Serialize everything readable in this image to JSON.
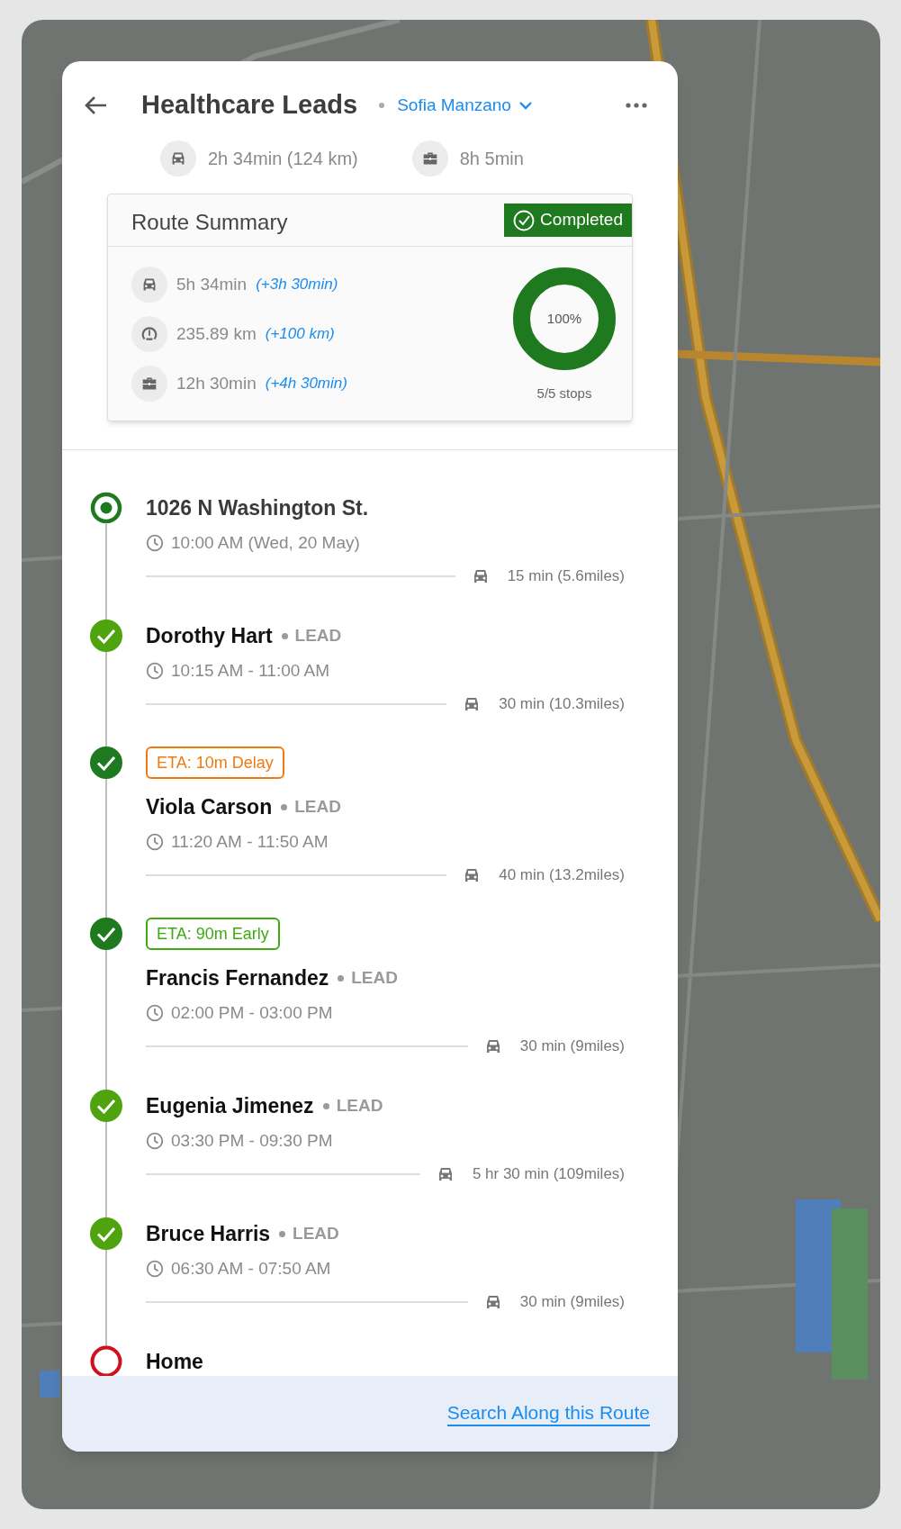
{
  "header": {
    "title": "Healthcare Leads",
    "assignee": "Sofia Manzano"
  },
  "totals": [
    {
      "kind": "drive",
      "text": "2h 34min (124 km)"
    },
    {
      "kind": "work",
      "text": "8h 5min"
    }
  ],
  "route_summary": {
    "title": "Route Summary",
    "status": "Completed",
    "rows": [
      {
        "kind": "drive",
        "value": "5h 34min",
        "delta": "(+3h 30min)"
      },
      {
        "kind": "distance",
        "value": "235.89 km",
        "delta": "(+100 km)"
      },
      {
        "kind": "work",
        "value": "12h 30min",
        "delta": "(+4h 30min)"
      }
    ],
    "progress": {
      "level": 1,
      "label": "100%",
      "stops": "5/5 stops"
    }
  },
  "stops": [
    {
      "kind": "start",
      "color": "#1f7a1f",
      "name": "1026 N Washington St.",
      "time": "10:00 AM (Wed, 20 May)",
      "leg": "15 min (5.6miles)"
    },
    {
      "kind": "completed",
      "color": "#4ea30f",
      "name": "Dorothy Hart",
      "tag": "LEAD",
      "time": "10:15 AM - 11:00 AM",
      "leg": "30 min (10.3miles)"
    },
    {
      "kind": "completed",
      "color": "#1f7a1f",
      "eta": {
        "kind": "delay",
        "text": "ETA: 10m Delay"
      },
      "name": "Viola Carson",
      "tag": "LEAD",
      "time": "11:20 AM - 11:50 AM",
      "leg": "40 min (13.2miles)"
    },
    {
      "kind": "completed",
      "color": "#1f7a1f",
      "eta": {
        "kind": "early",
        "text": "ETA: 90m Early"
      },
      "name": "Francis Fernandez",
      "tag": "LEAD",
      "time": "02:00 PM - 03:00 PM",
      "leg": "30 min (9miles)"
    },
    {
      "kind": "completed",
      "color": "#4ea30f",
      "name": "Eugenia Jimenez",
      "tag": "LEAD",
      "time": "03:30 PM - 09:30 PM",
      "leg": "5 hr 30 min (109miles)"
    },
    {
      "kind": "completed",
      "color": "#4ea30f",
      "name": "Bruce Harris",
      "tag": "LEAD",
      "time": "06:30 AM - 07:50 AM",
      "leg": "30 min (9miles)"
    },
    {
      "kind": "end",
      "color": "#d0101a",
      "name": "Home"
    }
  ],
  "footer_link": "Search Along this Route"
}
